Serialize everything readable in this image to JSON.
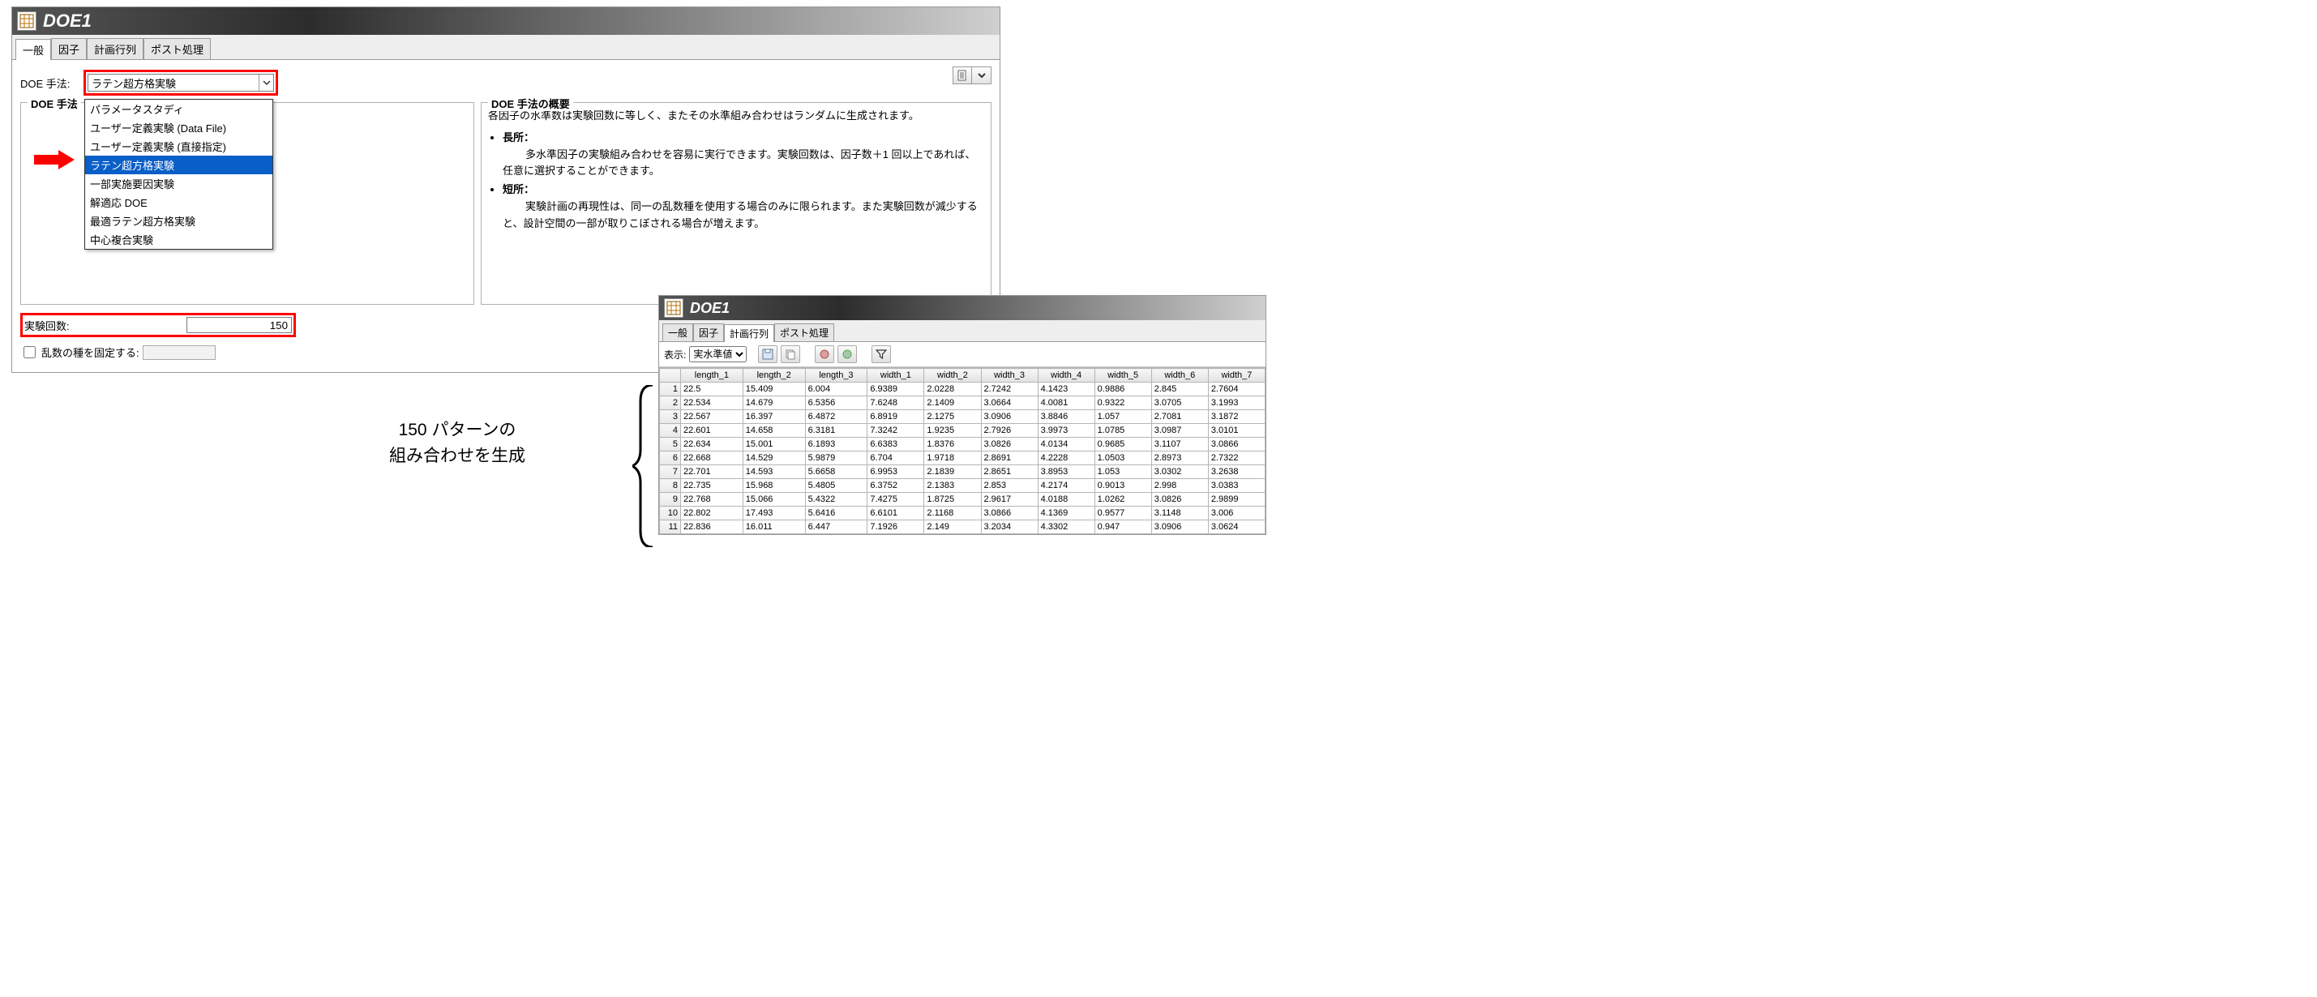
{
  "window_title": "DOE1",
  "tabs": [
    "一般",
    "因子",
    "計画行列",
    "ポスト処理"
  ],
  "active_tab_index_panel1": 0,
  "doe_method_label": "DOE 手法:",
  "doe_method_value": "ラテン超方格実験",
  "doe_method_options": [
    "パラメータスタディ",
    "ユーザー定義実験 (Data File)",
    "ユーザー定義実験 (直接指定)",
    "ラテン超方格実験",
    "一部実施要因実験",
    "解適応 DOE",
    "最適ラテン超方格実験",
    "中心複合実験"
  ],
  "doe_method_selected_index": 3,
  "fieldset_left_legend": "DOE 手法",
  "fieldset_right_legend": "DOE 手法の概要",
  "description_intro": "各因子の水準数は実験回数に等しく、またその水準組み合わせはランダムに生成されます。",
  "description_pro_label": "長所：",
  "description_pro_text": "多水準因子の実験組み合わせを容易に実行できます。実験回数は、因子数＋1 回以上であれば、任意に選択することができます。",
  "description_con_label": "短所：",
  "description_con_text": "実験計画の再現性は、同一の乱数種を使用する場合のみに限られます。また実験回数が減少すると、設計空間の一部が取りこぼされる場合が増えます。",
  "numruns_label": "実験回数:",
  "numruns_value": "150",
  "fixseed_label": "乱数の種を固定する:",
  "panel2_active_tab_index": 2,
  "panel2_display_label": "表示:",
  "panel2_display_value": "実水準値",
  "table_columns": [
    "length_1",
    "length_2",
    "length_3",
    "width_1",
    "width_2",
    "width_3",
    "width_4",
    "width_5",
    "width_6",
    "width_7"
  ],
  "table_rows": [
    [
      "22.5",
      "15.409",
      "6.004",
      "6.9389",
      "2.0228",
      "2.7242",
      "4.1423",
      "0.9886",
      "2.845",
      "2.7604"
    ],
    [
      "22.534",
      "14.679",
      "6.5356",
      "7.6248",
      "2.1409",
      "3.0664",
      "4.0081",
      "0.9322",
      "3.0705",
      "3.1993"
    ],
    [
      "22.567",
      "16.397",
      "6.4872",
      "6.8919",
      "2.1275",
      "3.0906",
      "3.8846",
      "1.057",
      "2.7081",
      "3.1872"
    ],
    [
      "22.601",
      "14.658",
      "6.3181",
      "7.3242",
      "1.9235",
      "2.7926",
      "3.9973",
      "1.0785",
      "3.0987",
      "3.0101"
    ],
    [
      "22.634",
      "15.001",
      "6.1893",
      "6.6383",
      "1.8376",
      "3.0826",
      "4.0134",
      "0.9685",
      "3.1107",
      "3.0866"
    ],
    [
      "22.668",
      "14.529",
      "5.9879",
      "6.704",
      "1.9718",
      "2.8691",
      "4.2228",
      "1.0503",
      "2.8973",
      "2.7322"
    ],
    [
      "22.701",
      "14.593",
      "5.6658",
      "6.9953",
      "2.1839",
      "2.8651",
      "3.8953",
      "1.053",
      "3.0302",
      "3.2638"
    ],
    [
      "22.735",
      "15.968",
      "5.4805",
      "6.3752",
      "2.1383",
      "2.853",
      "4.2174",
      "0.9013",
      "2.998",
      "3.0383"
    ],
    [
      "22.768",
      "15.066",
      "5.4322",
      "7.4275",
      "1.8725",
      "2.9617",
      "4.0188",
      "1.0262",
      "3.0826",
      "2.9899"
    ],
    [
      "22.802",
      "17.493",
      "5.6416",
      "6.6101",
      "2.1168",
      "3.0866",
      "4.1369",
      "0.9577",
      "3.1148",
      "3.006"
    ],
    [
      "22.836",
      "16.011",
      "6.447",
      "7.1926",
      "2.149",
      "3.2034",
      "4.3302",
      "0.947",
      "3.0906",
      "3.0624"
    ]
  ],
  "annotation_line1": "150 パターンの",
  "annotation_line2": "組み合わせを生成"
}
